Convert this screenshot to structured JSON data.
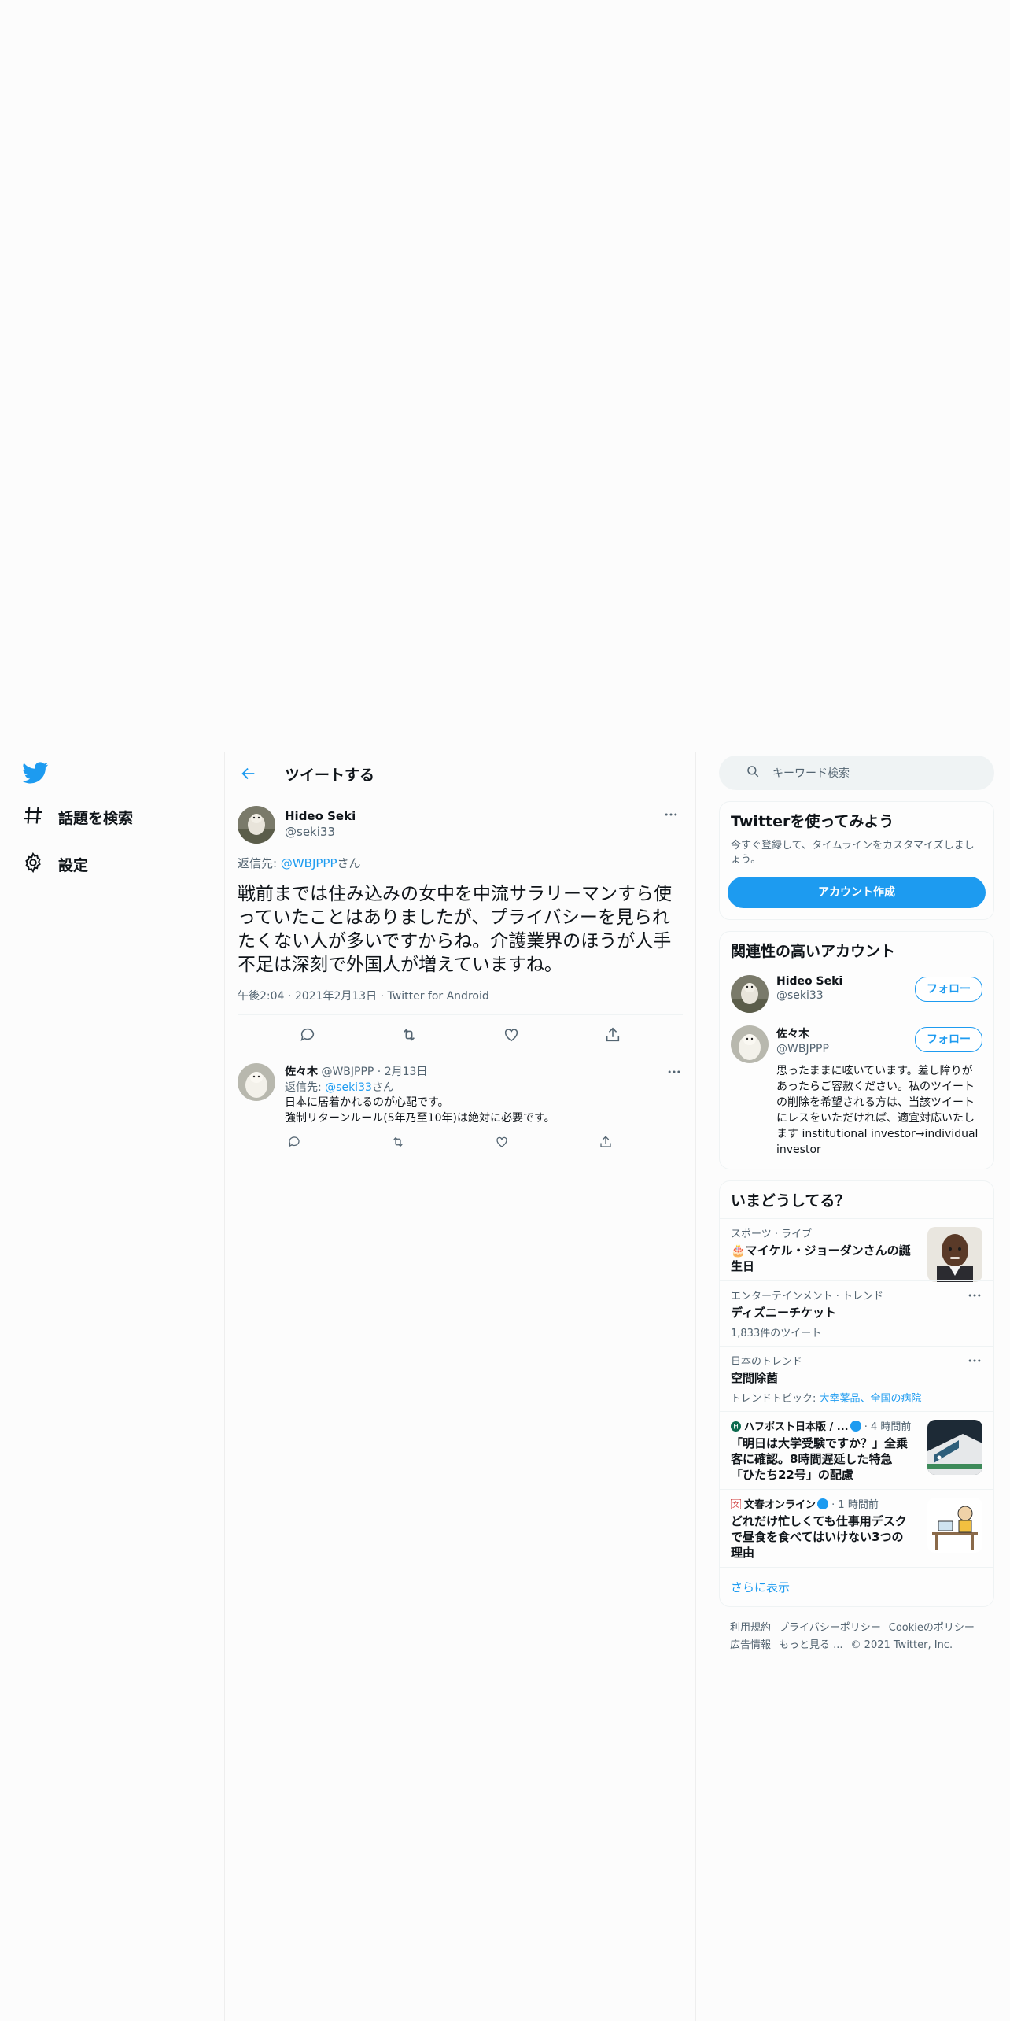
{
  "nav": {
    "explore_label": "話題を検索",
    "settings_label": "設定"
  },
  "main": {
    "title": "ツイートする"
  },
  "focus_tweet": {
    "name": "Hideo Seki",
    "handle": "@seki33",
    "reply_prefix": "返信先: ",
    "reply_mention": "@WBJPPP",
    "reply_suffix": "さん",
    "body": "戦前までは住み込みの女中を中流サラリーマンすら使っていたことはありましたが、プライバシーを見られたくない人が多いですからね。介護業界のほうが人手不足は深刻で外国人が増えていますね。",
    "time": "午後2:04",
    "date": "2021年2月13日",
    "client": "Twitter for Android"
  },
  "reply_tweet": {
    "name": "佐々木",
    "handle": "@WBJPPP",
    "date": "2月13日",
    "reply_prefix": "返信先: ",
    "reply_mention": "@seki33",
    "reply_suffix": "さん",
    "line1": "日本に居着かれるのが心配です。",
    "line2": "強制リターンルール(5年乃至10年)は絶対に必要です。"
  },
  "sidebar": {
    "search_placeholder": "キーワード検索",
    "signup": {
      "title": "Twitterを使ってみよう",
      "desc": "今すぐ登録して、タイムラインをカスタマイズしましょう。",
      "button": "アカウント作成"
    },
    "related": {
      "title": "関連性の高いアカウント",
      "follow_label": "フォロー",
      "accounts": [
        {
          "name": "Hideo Seki",
          "handle": "@seki33"
        },
        {
          "name": "佐々木",
          "handle": "@WBJPPP",
          "bio": "思ったままに呟いています。差し障りがあったらご容赦ください。私のツイートの削除を希望される方は、当該ツイートにレスをいただければ、適宜対応いたします institutional investor→individual investor"
        }
      ]
    },
    "trends": {
      "title": "いまどうしてる？",
      "items": [
        {
          "context": "スポーツ · ライブ",
          "title": "🎂マイケル・ジョーダンさんの誕生日"
        },
        {
          "context": "エンターテインメント · トレンド",
          "title": "ディズニーチケット",
          "sub": "1,833件のツイート"
        },
        {
          "context": "日本のトレンド",
          "title": "空間除菌",
          "sub_prefix": "トレンドトピック: ",
          "sub_link": "大幸薬品、全国の病院"
        },
        {
          "source": "ハフポスト日本版 / ...",
          "time": "4 時間前",
          "title": "「明日は大学受験ですか？」全乗客に確認。8時間遅延した特急「ひたち22号」の配慮"
        },
        {
          "source": "文春オンライン",
          "time": "1 時間前",
          "title": "どれだけ忙しくても仕事用デスクで昼食を食べてはいけない3つの理由"
        }
      ],
      "show_more": "さらに表示"
    },
    "footer": {
      "links": [
        "利用規約",
        "プライバシーポリシー",
        "Cookieのポリシー",
        "広告情報",
        "もっと見る ..."
      ],
      "copyright": "© 2021 Twitter, Inc."
    }
  }
}
